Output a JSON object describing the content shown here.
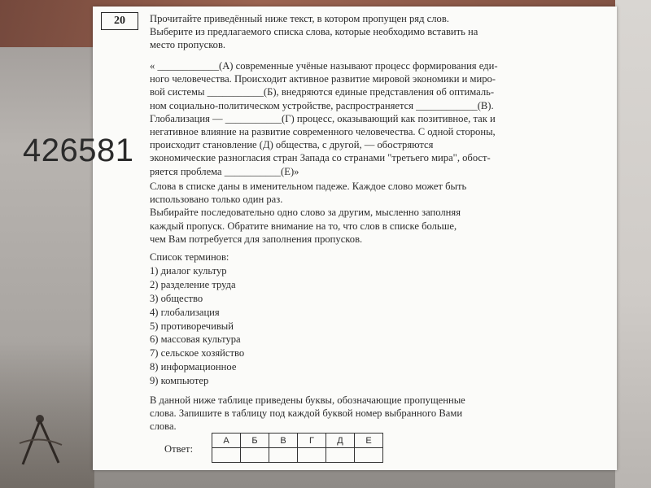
{
  "overlay_number": "426581",
  "task": {
    "number": "20",
    "instruction": [
      "Прочитайте приведённый ниже текст, в котором пропущен ряд слов.",
      "Выберите из предлагаемого списка слова, которые необходимо вставить на",
      "место пропусков."
    ],
    "passage": [
      "« ____________(А) современные учёные называют процесс формирования еди-",
      "ного человечества. Происходит активное развитие мировой экономики и миро-",
      "вой системы ___________(Б), внедряются единые представления об оптималь-",
      "ном социально-политическом устройстве, распространяется ____________(В).",
      "Глобализация — ___________(Г) процесс, оказывающий как позитивное, так и",
      "негативное влияние на развитие современного человечества. С одной стороны,",
      "происходит становление                 (Д) общества, с другой, — обостряются",
      "экономические разногласия стран Запада со странами \"третьего мира\", обост-",
      "ряется проблема ___________(Е)»"
    ],
    "rules": [
      "Слова в списке даны в именительном падеже. Каждое слово может быть",
      "использовано только один раз.",
      "Выбирайте последовательно одно слово за другим, мысленно заполняя",
      "каждый пропуск. Обратите внимание на то, что слов в списке больше,",
      "чем Вам потребуется для заполнения пропусков."
    ],
    "terms_title": "Список терминов:",
    "terms": [
      "1) диалог культур",
      "2) разделение труда",
      "3) общество",
      "4) глобализация",
      "5) противоречивый",
      "6) массовая культура",
      "7) сельское хозяйство",
      "8) информационное",
      "9) компьютер"
    ],
    "table_instruction": [
      "В данной ниже таблице приведены буквы, обозначающие пропущенные",
      "слова. Запишите в таблицу под каждой буквой номер выбранного Вами",
      "слова."
    ],
    "answer_label": "Ответ:",
    "answer_letters": [
      "А",
      "Б",
      "В",
      "Г",
      "Д",
      "Е"
    ],
    "answer_values": [
      "",
      "",
      "",
      "",
      "",
      ""
    ]
  }
}
